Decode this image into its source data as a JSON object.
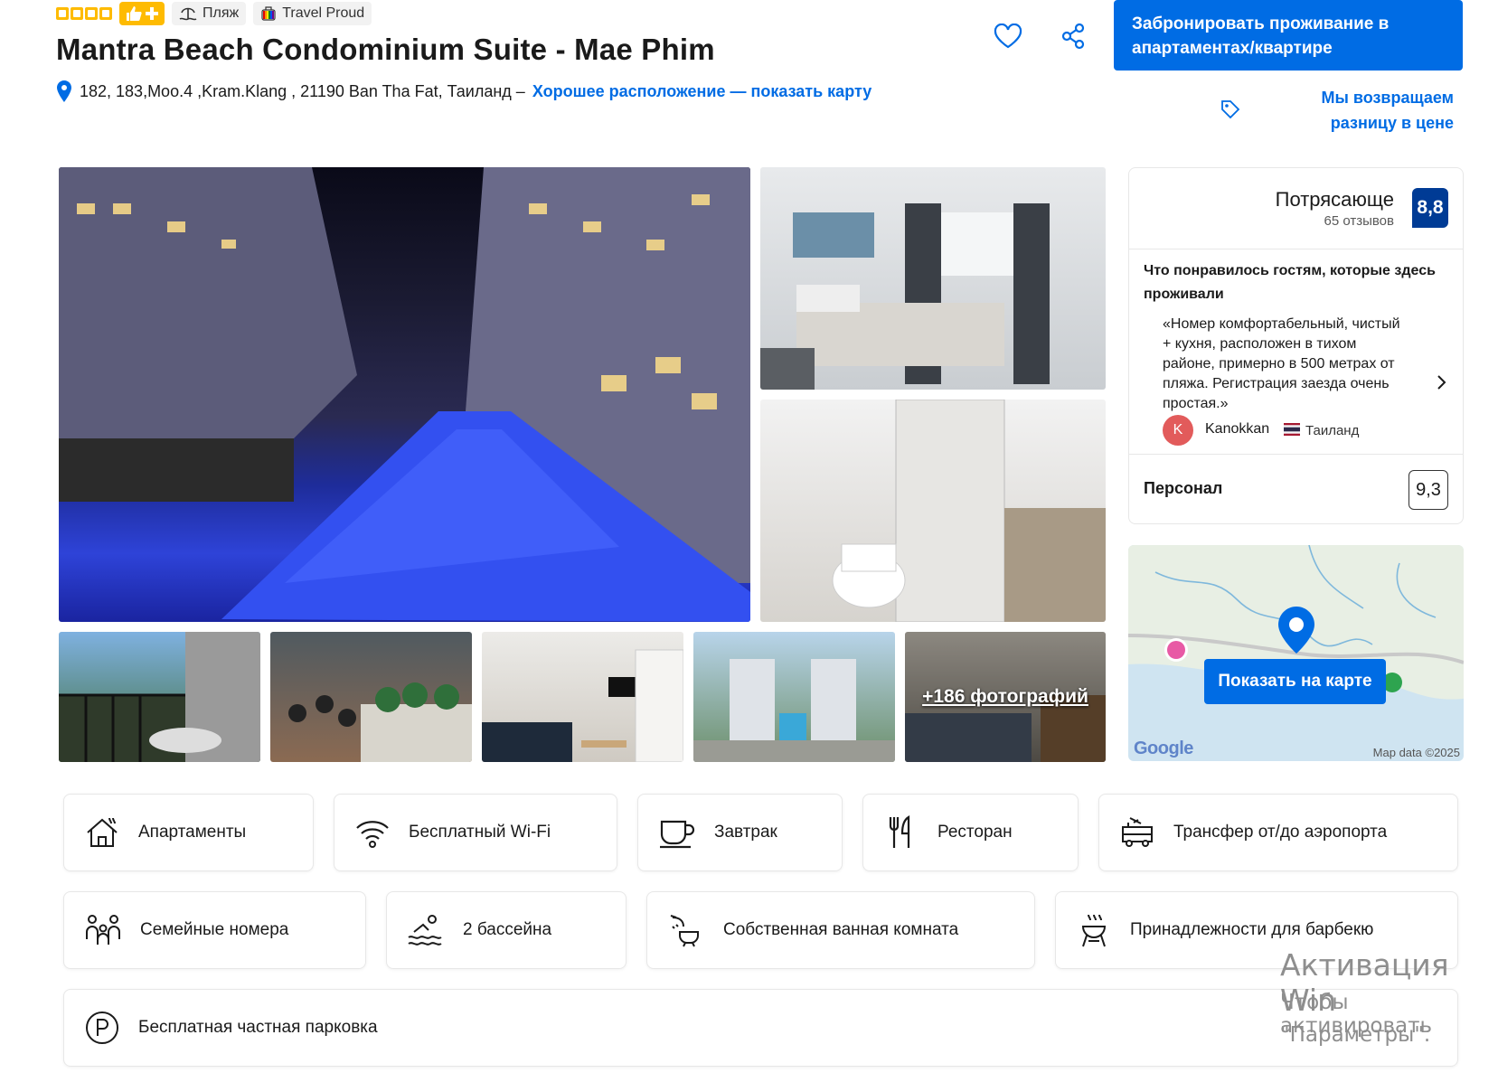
{
  "header": {
    "star_count": 4,
    "badges": [
      {
        "icon": "beach-icon",
        "label": "Пляж"
      },
      {
        "icon": "travel-proud-icon",
        "label": "Travel Proud"
      }
    ],
    "title": "Mantra Beach Condominium Suite - Mae Phim",
    "address": "182, 183,Moo.4 ,Kram.Klang , 21190 Ban Tha Fat, Таиланд –",
    "location_link": "Хорошее расположение — показать карту",
    "book_button": "Забронировать проживание в апартаментах/квартире",
    "price_match": "Мы возвращаем разницу в цене"
  },
  "gallery": {
    "more_photos": "+186 фотографий",
    "photos": [
      "pool-night",
      "bedroom",
      "bathroom",
      "balcony",
      "restaurant",
      "living-room",
      "aerial-view",
      "bedroom-2"
    ]
  },
  "review": {
    "rating_word": "Потрясающе",
    "review_count": "65 отзывов",
    "score": "8,8",
    "liked_heading": "Что понравилось гостям, которые здесь проживали",
    "quote": "«Номер комфортабельный, чистый + кухня, расположен в тихом районе, примерно в 500 метрах от пляжа. Регистрация заезда очень простая.»",
    "reviewer_initial": "K",
    "reviewer_name": "Kanokkan",
    "reviewer_country": "Таиланд",
    "staff_label": "Персонал",
    "staff_score": "9,3"
  },
  "map": {
    "button": "Показать на карте",
    "google": "Google",
    "copyright": "Map data ©2025"
  },
  "facilities": [
    {
      "icon": "apartment-icon",
      "label": "Апартаменты"
    },
    {
      "icon": "wifi-icon",
      "label": "Бесплатный Wi-Fi"
    },
    {
      "icon": "breakfast-icon",
      "label": "Завтрак"
    },
    {
      "icon": "restaurant-icon",
      "label": "Ресторан"
    },
    {
      "icon": "shuttle-icon",
      "label": "Трансфер от/до аэропорта"
    },
    {
      "icon": "family-icon",
      "label": "Семейные номера"
    },
    {
      "icon": "pool-icon",
      "label": "2 бассейна"
    },
    {
      "icon": "bathroom-icon",
      "label": "Собственная ванная комната"
    },
    {
      "icon": "bbq-icon",
      "label": "Принадлежности для барбекю"
    },
    {
      "icon": "parking-icon",
      "label": "Бесплатная частная парковка"
    }
  ],
  "watermark": {
    "line1": "Активация Win",
    "line2": "Чтобы активировать",
    "line3": "\"Параметры\"."
  },
  "colors": {
    "primary": "#006ce4",
    "score_bg": "#003b95",
    "star": "#febb02"
  }
}
